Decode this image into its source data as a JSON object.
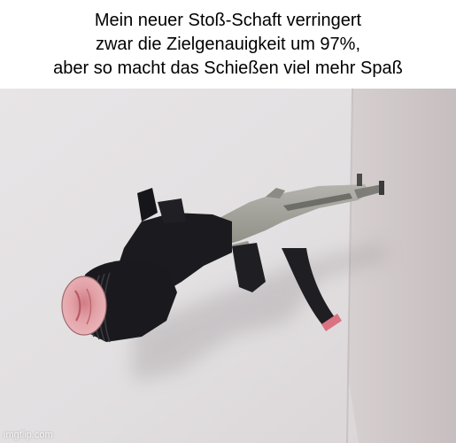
{
  "caption": {
    "lines": [
      "Mein neuer Stoß-Schaft verringert",
      "zwar die Zielgenauigkeit um 97%,",
      "aber so macht das Schießen viel mehr Spaß"
    ]
  },
  "watermark": {
    "text": "imgflip.com"
  },
  "photo": {
    "colors": {
      "wall": "#e4e1e3",
      "wall_right": "#cfc8c8",
      "gun_metal": "#9d9d95",
      "gun_black": "#1b1b1f",
      "pink_accent": "#e5a1a6",
      "magazine_tip": "#d97383"
    }
  }
}
